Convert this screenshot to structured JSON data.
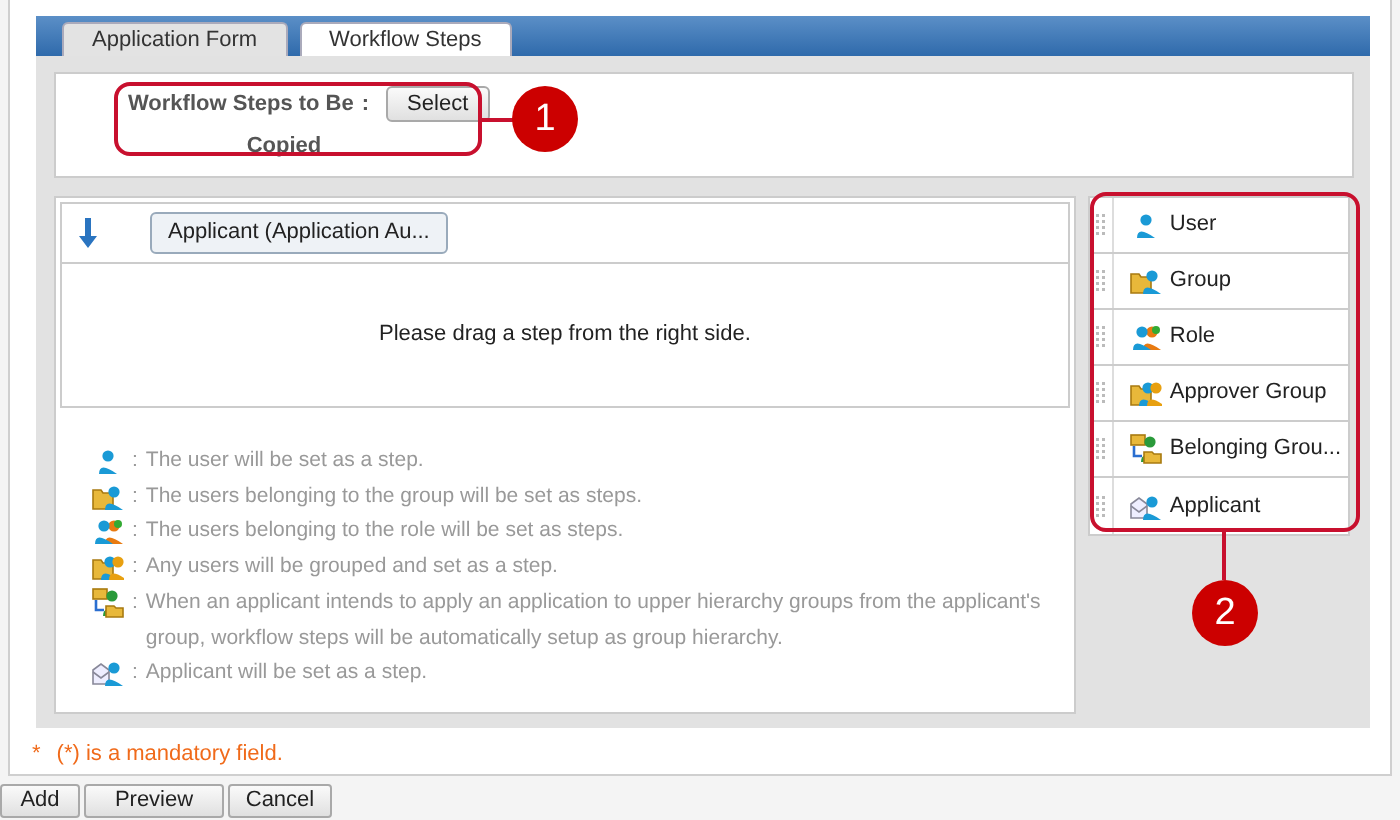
{
  "tabs": [
    {
      "label": "Application Form",
      "selected": false
    },
    {
      "label": "Workflow Steps",
      "selected": true
    }
  ],
  "copy_source": {
    "label_lines": [
      "Workflow Steps to Be",
      "Copied"
    ],
    "separator": ":",
    "button": "Select"
  },
  "steps": [
    {
      "label": "Applicant (Application Au..."
    }
  ],
  "drop_hint": "Please drag a step from the right side.",
  "palette": [
    {
      "kind": "user",
      "label": "User"
    },
    {
      "kind": "group",
      "label": "Group"
    },
    {
      "kind": "role",
      "label": "Role"
    },
    {
      "kind": "approver-group",
      "label": "Approver Group"
    },
    {
      "kind": "belonging-group",
      "label": "Belonging Grou..."
    },
    {
      "kind": "applicant",
      "label": "Applicant"
    }
  ],
  "legend": [
    {
      "kind": "user",
      "separator": ":",
      "text": "The user will be set as a step."
    },
    {
      "kind": "group",
      "separator": ":",
      "text": "The users belonging to the group will be set as steps."
    },
    {
      "kind": "role",
      "separator": ":",
      "text": "The users belonging to the role will be set as steps."
    },
    {
      "kind": "approver-group",
      "separator": ":",
      "text": "Any users will be grouped and set as a step."
    },
    {
      "kind": "belonging-group",
      "separator": ":",
      "text": "When an applicant intends to apply an application to upper hierarchy groups from the applicant's group, workflow steps will be automatically setup as group hierarchy."
    },
    {
      "kind": "applicant",
      "separator": ":",
      "text": "Applicant will be set as a step."
    }
  ],
  "mandatory_note": {
    "mark": "*",
    "text": "(*) is a mandatory field."
  },
  "callouts": [
    "1",
    "2"
  ],
  "buttons": [
    "Add",
    "Preview",
    "Cancel"
  ]
}
